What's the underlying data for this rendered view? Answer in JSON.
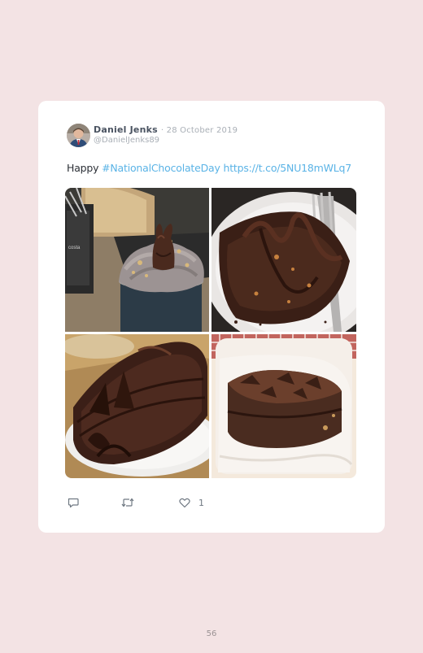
{
  "tweet": {
    "author_name": "Daniel Jenks",
    "date": "· 28 October 2019",
    "handle": "@DanielJenks89",
    "text_prefix": "Happy ",
    "hashtag": "#NationalChocolateDay",
    "url": "https://t.co/5NU18mWLq7",
    "likes": "1",
    "photos": [
      {
        "name": "chocolate-bunny-hot-chocolate-photo"
      },
      {
        "name": "chocolate-brownie-drizzle-photo"
      },
      {
        "name": "chocolate-layer-cake-slice-photo"
      },
      {
        "name": "chocolate-brownie-napkin-photo"
      }
    ]
  },
  "icons": {
    "reply": "reply-icon",
    "retweet": "retweet-icon",
    "like": "heart-icon"
  },
  "colors": {
    "page_background": "#f3e3e4",
    "card_background": "#ffffff",
    "link": "#5ab3e6",
    "author": "#4a5361",
    "muted": "#a9afb6"
  },
  "page": {
    "number": "56"
  }
}
